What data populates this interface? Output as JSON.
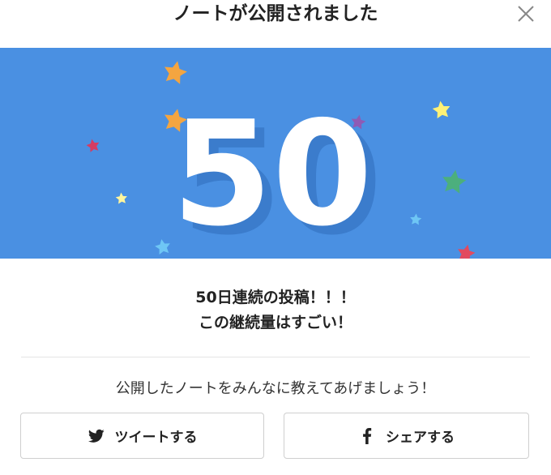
{
  "dialog": {
    "title": "ノートが公開されました",
    "close_icon": "close-icon"
  },
  "banner": {
    "count": "50",
    "background_color": "#4a90e2",
    "number_color": "#ffffff",
    "shadow_color": "#3a7bd0"
  },
  "message": {
    "line1": "50日連続の投稿！！！",
    "line2": "この継続量はすごい！"
  },
  "share": {
    "prompt": "公開したノートをみんなに教えてあげましょう！",
    "tweet_label": "ツイートする",
    "tweet_icon": "twitter-bird-icon",
    "facebook_label": "シェアする",
    "facebook_icon": "facebook-f-icon"
  }
}
